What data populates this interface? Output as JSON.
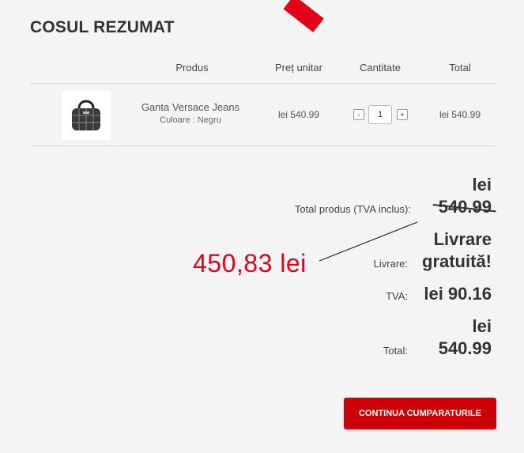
{
  "page": {
    "title": "COSUL REZUMAT"
  },
  "table": {
    "headers": [
      "Produs",
      "Preț unitar",
      "Cantitate",
      "Total"
    ],
    "rows": [
      {
        "name": "Ganta Versace Jeans",
        "variant": "Culoare : Negru",
        "unit_price": "lei 540.99",
        "quantity": "1",
        "decrement_label": "-",
        "increment_label": "+",
        "total": "lei 540.99"
      }
    ]
  },
  "summary": {
    "products_total_label": "Total produs (TVA inclus):",
    "products_total_currency": "lei",
    "products_total_value": "540.99",
    "delivery_label": "Livrare:",
    "delivery_line1": "Livrare",
    "delivery_line2": "gratuită!",
    "vat_label": "TVA:",
    "vat_value": "lei 90.16",
    "total_label": "Total:",
    "total_currency": "lei",
    "total_value": "540.99"
  },
  "annotation": {
    "new_price": "450,83 lei",
    "color": "#e3001b"
  },
  "actions": {
    "continue_label": "CONTINUA CUMPARATURILE"
  },
  "colors": {
    "accent": "#cc0007",
    "background": "#f4f4f4"
  },
  "icons": {
    "product_image": "handbag-icon"
  }
}
